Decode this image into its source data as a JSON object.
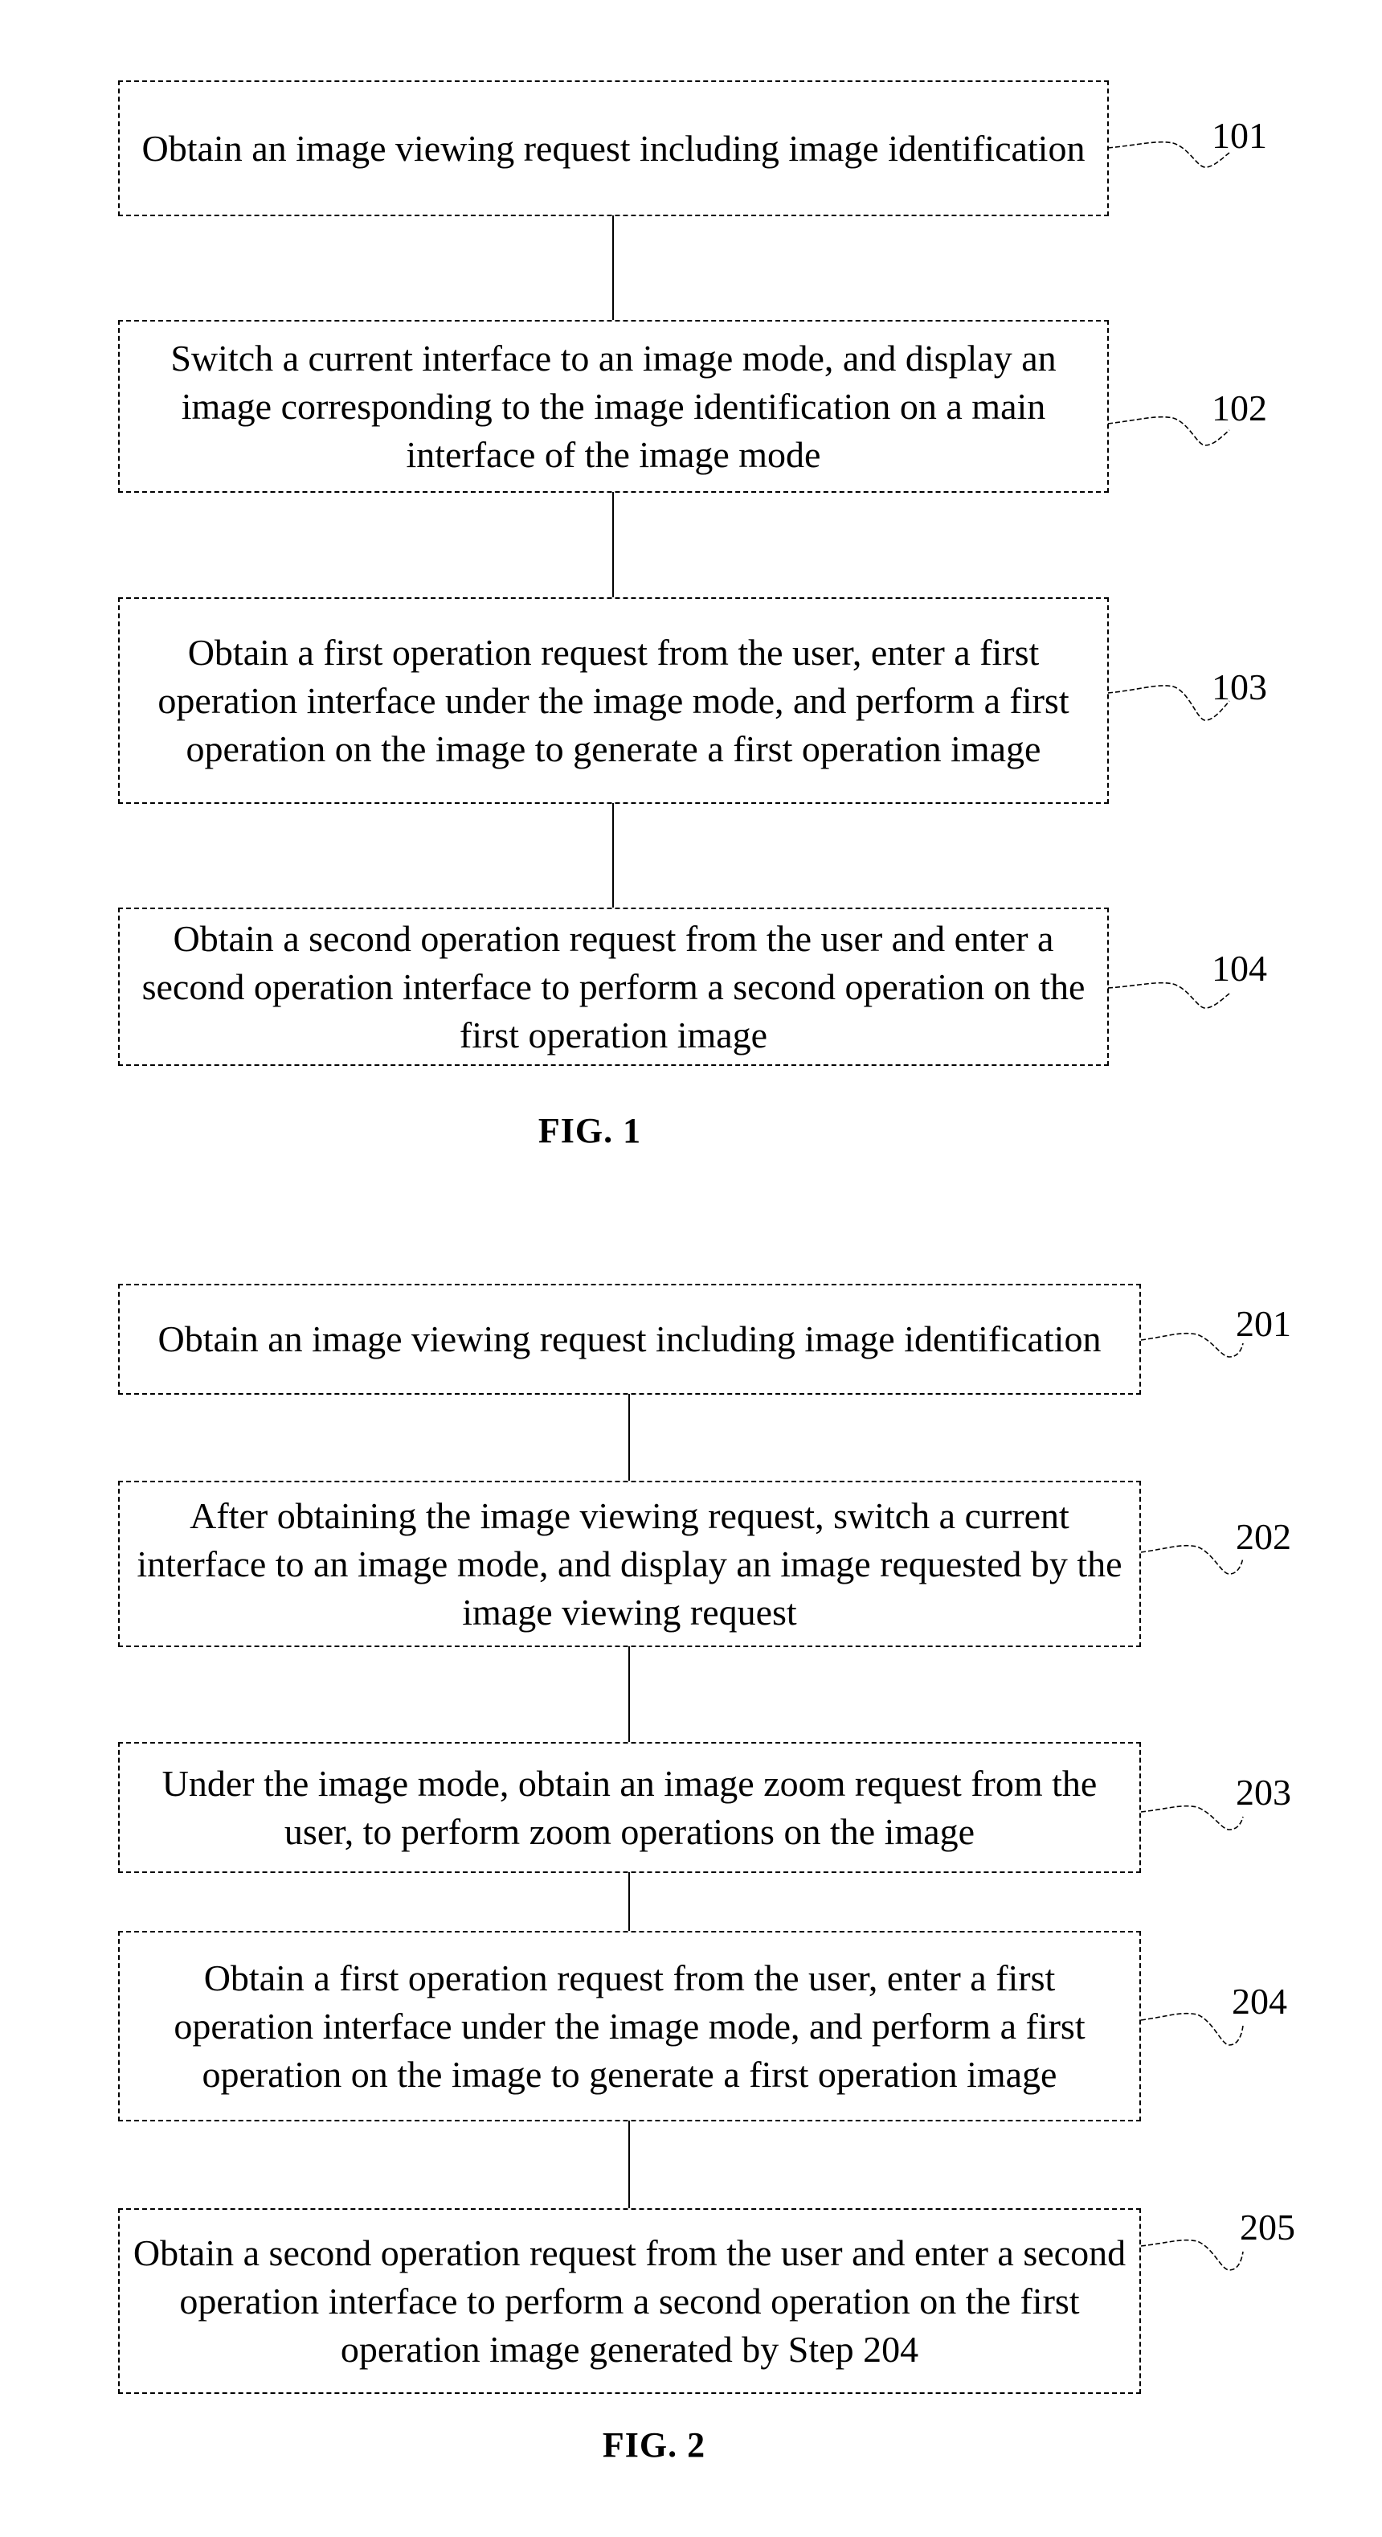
{
  "figures": [
    {
      "caption": "FIG. 1",
      "steps": [
        {
          "ref": "101",
          "text": "Obtain an image viewing request including image identification"
        },
        {
          "ref": "102",
          "text": "Switch a current interface to an image mode, and display an image corresponding to the image identification on a main interface of the image mode"
        },
        {
          "ref": "103",
          "text": "Obtain a first operation request from the user, enter a first operation interface under the image mode, and perform a first operation on the image to generate a first operation image"
        },
        {
          "ref": "104",
          "text": "Obtain a second operation request from the user and enter a second operation interface to perform a second operation on the first operation image"
        }
      ]
    },
    {
      "caption": "FIG. 2",
      "steps": [
        {
          "ref": "201",
          "text": "Obtain an image viewing request including image identification"
        },
        {
          "ref": "202",
          "text": "After obtaining the image viewing request, switch a current interface to an image mode, and display an image requested by the image viewing request"
        },
        {
          "ref": "203",
          "text": "Under the image mode, obtain an image zoom request from the user, to perform zoom operations on the image"
        },
        {
          "ref": "204",
          "text": "Obtain a first operation request from the user, enter a first operation interface under the image mode, and perform a first operation on the image to generate a first operation image"
        },
        {
          "ref": "205",
          "text": "Obtain a second operation request from the user and enter a second operation interface to perform a second operation on the first operation image generated by Step 204"
        }
      ]
    }
  ]
}
